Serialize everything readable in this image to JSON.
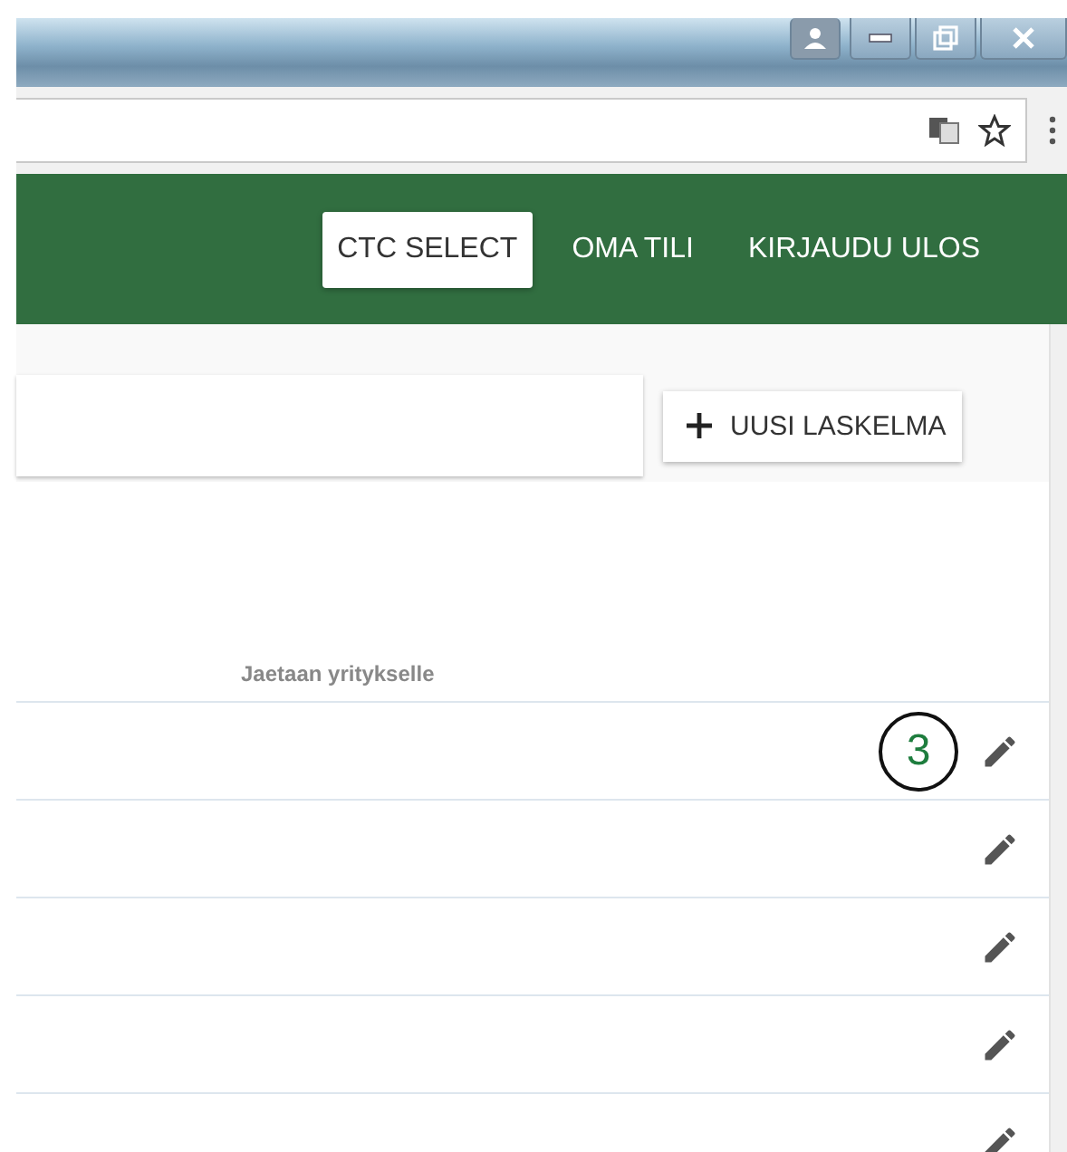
{
  "nav": {
    "items": [
      {
        "label": "CTC SELECT",
        "selected": true
      },
      {
        "label": "OMA TILI",
        "selected": false
      },
      {
        "label": "KIRJAUDU ULOS",
        "selected": false
      }
    ]
  },
  "new_button": {
    "label": "UUSI LASKELMA"
  },
  "table": {
    "columns": [
      {
        "label": "Jaetaan yritykselle"
      }
    ],
    "rows": [
      {
        "callout": "3"
      },
      {},
      {},
      {},
      {}
    ]
  }
}
